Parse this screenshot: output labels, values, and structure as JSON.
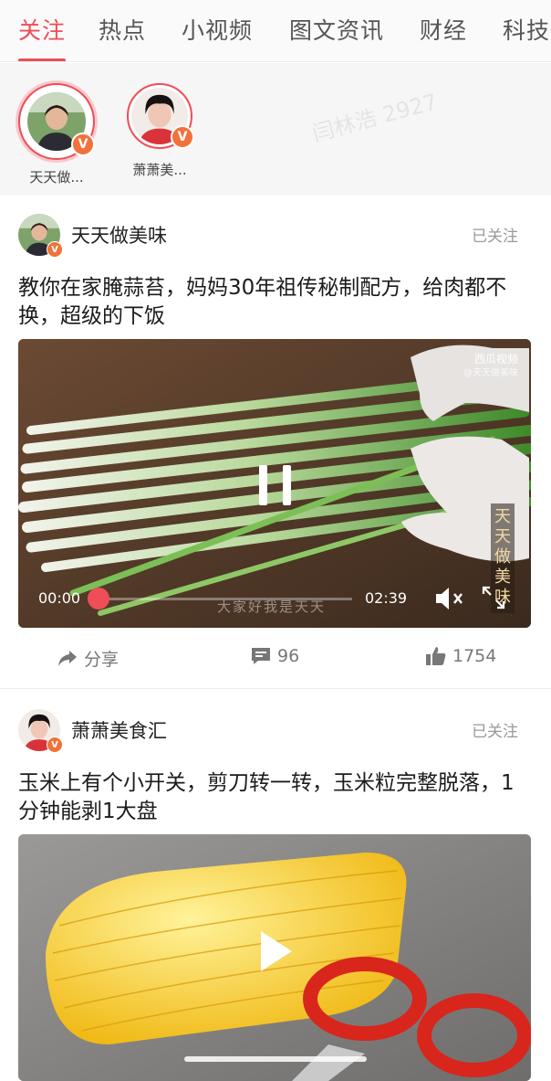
{
  "tabs": [
    {
      "label": "关注",
      "active": true
    },
    {
      "label": "热点",
      "active": false
    },
    {
      "label": "小视频",
      "active": false
    },
    {
      "label": "图文资讯",
      "active": false
    },
    {
      "label": "财经",
      "active": false
    },
    {
      "label": "科技",
      "active": false
    }
  ],
  "following": [
    {
      "name": "天天做...",
      "badge": "V"
    },
    {
      "name": "萧萧美...",
      "badge": "V"
    }
  ],
  "watermark": "闫林浩 2927",
  "posts": [
    {
      "author": "天天做美味",
      "follow_status": "已关注",
      "title": "教你在家腌蒜苔，妈妈30年祖传秘制配方，给肉都不换，超级的下饭",
      "video": {
        "state": "playing",
        "current_time": "00:00",
        "duration": "02:39",
        "progress": 0.0,
        "subtitle": "大家好我是天天",
        "brand": "西瓜视频",
        "brand_handle": "@天天做美味",
        "side_caption": "天天做美味"
      },
      "share_label": "分享",
      "comments": "96",
      "likes": "1754"
    },
    {
      "author": "萧萧美食汇",
      "follow_status": "已关注",
      "title": "玉米上有个小开关，剪刀转一转，玉米粒完整脱落，1分钟能剥1大盘",
      "video": {
        "state": "paused"
      }
    }
  ],
  "colors": {
    "accent": "#ef4d57",
    "badge": "#f2713b"
  },
  "icons": {
    "share": "share-icon",
    "comment": "comment-icon",
    "like": "thumbs-up-icon",
    "mute": "mute-icon",
    "fullscreen": "fullscreen-icon"
  }
}
